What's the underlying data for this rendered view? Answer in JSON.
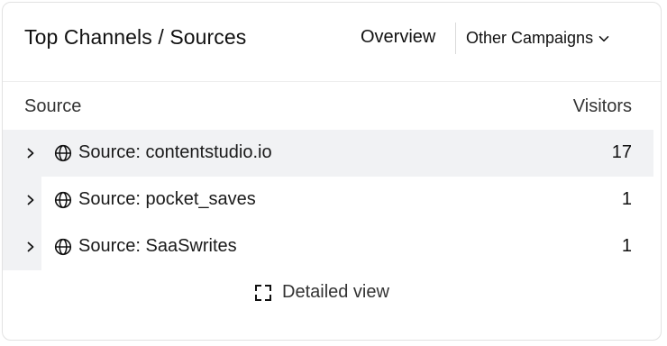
{
  "widget": {
    "title": "Top Channels / Sources",
    "tabs": {
      "overview": "Overview",
      "campaigns": "Other Campaigns"
    }
  },
  "table": {
    "columns": {
      "source": "Source",
      "visitors": "Visitors"
    },
    "rows": [
      {
        "label": "Source: contentstudio.io",
        "visitors": "17",
        "share": 1.0
      },
      {
        "label": "Source: pocket_saves",
        "visitors": "1",
        "share": 0.06
      },
      {
        "label": "Source: SaaSwrites",
        "visitors": "1",
        "share": 0.06
      }
    ]
  },
  "footer": {
    "detailed_label": "Detailed view"
  },
  "icons": {
    "row_expand": "chevron-right-icon",
    "row_source": "globe-icon",
    "campaigns_dropdown": "chevron-down-icon",
    "detailed_view": "expand-icon"
  },
  "colors": {
    "row_bar": "#f1f2f4",
    "text": "#111111",
    "border": "#e2e2e2"
  }
}
